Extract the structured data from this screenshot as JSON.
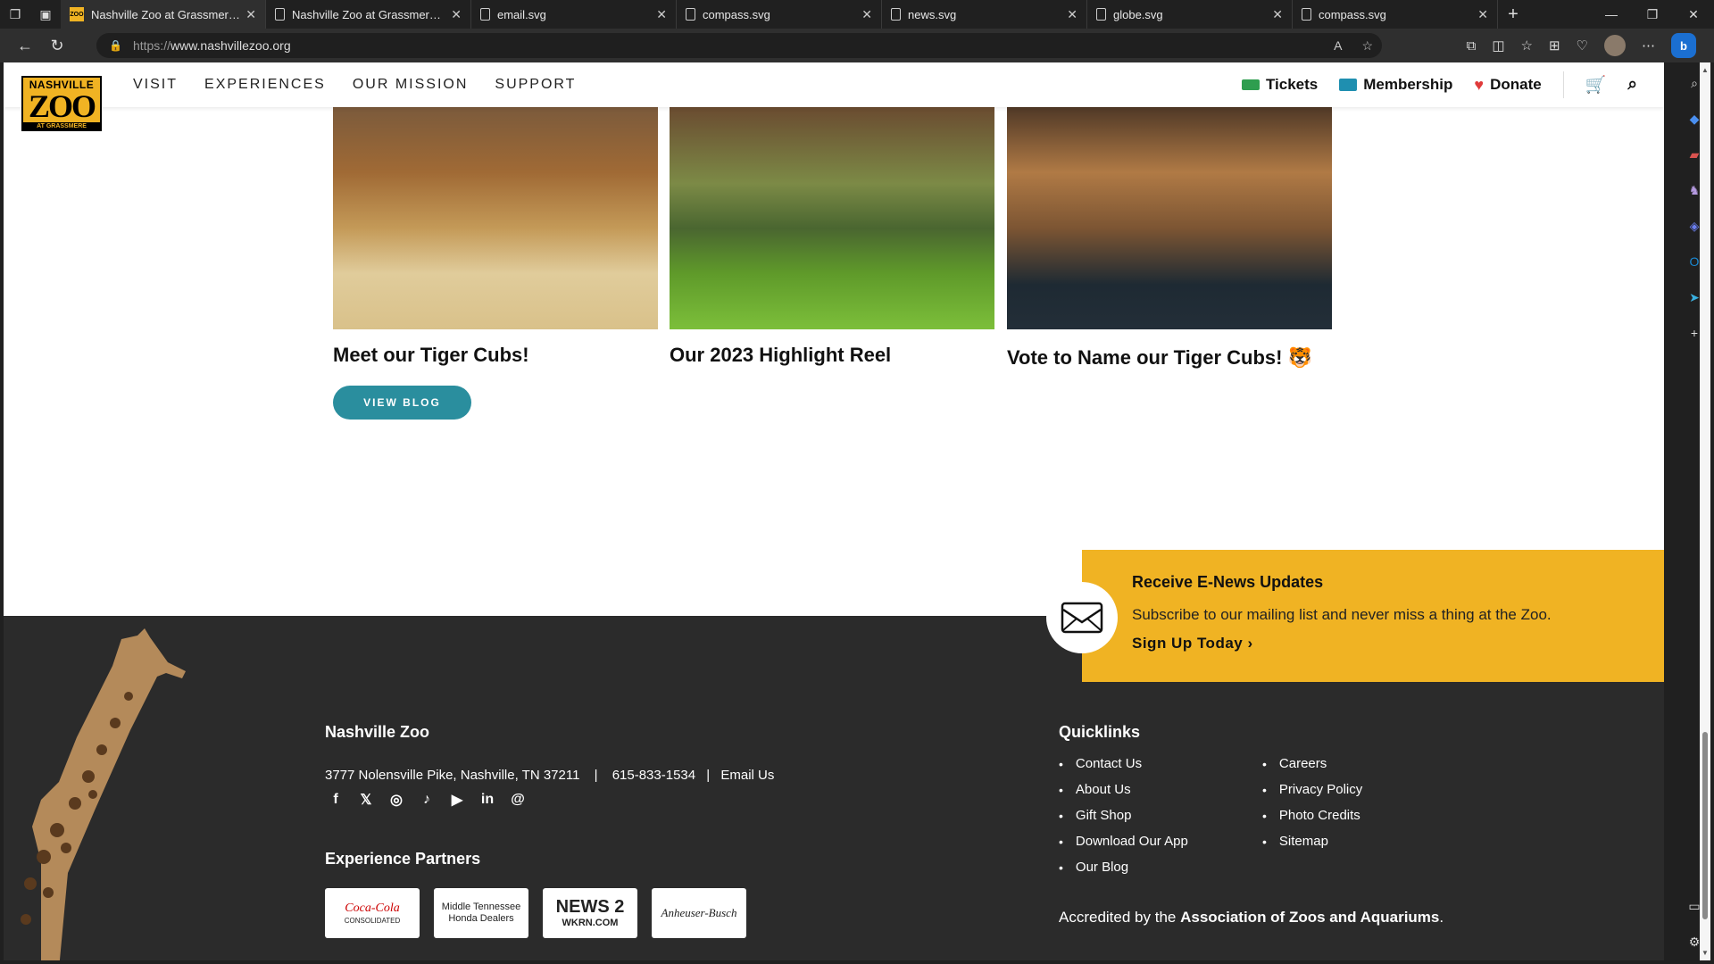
{
  "browser": {
    "tabs": [
      {
        "title": "Nashville Zoo at Grassmere | N",
        "active": true,
        "favicon": "zoo-favicon"
      },
      {
        "title": "Nashville Zoo at Grassmere | N",
        "active": false,
        "favicon": "page-icon"
      },
      {
        "title": "email.svg",
        "active": false,
        "favicon": "file-icon"
      },
      {
        "title": "compass.svg",
        "active": false,
        "favicon": "file-icon"
      },
      {
        "title": "news.svg",
        "active": false,
        "favicon": "file-icon"
      },
      {
        "title": "globe.svg",
        "active": false,
        "favicon": "file-icon"
      },
      {
        "title": "compass.svg",
        "active": false,
        "favicon": "file-icon"
      }
    ],
    "url_protocol": "https://",
    "url_host": "www.nashvillezoo.org"
  },
  "header": {
    "logo_top": "NASHVILLE",
    "logo_main": "ZOO",
    "logo_bottom": "AT GRASSMERE",
    "nav": [
      "VISIT",
      "EXPERIENCES",
      "OUR MISSION",
      "SUPPORT"
    ],
    "tickets": "Tickets",
    "membership": "Membership",
    "donate": "Donate"
  },
  "blog": {
    "cards": [
      {
        "title": "Meet our Tiger Cubs!"
      },
      {
        "title": "Our 2023 Highlight Reel"
      },
      {
        "title": "Vote to Name our Tiger Cubs! 🐯"
      }
    ],
    "button": "VIEW BLOG"
  },
  "enews": {
    "title": "Receive E-News Updates",
    "text": "Subscribe to our mailing list and never miss a thing at the Zoo.",
    "link": "Sign Up Today ›"
  },
  "footer": {
    "title": "Nashville Zoo",
    "address": "3777 Nolensville Pike, Nashville, TN 37211",
    "divider": "|",
    "phone": "615-833-1534",
    "email": "Email Us",
    "partners_title": "Experience Partners",
    "partners": [
      {
        "name": "Coca-Cola",
        "sub": "CONSOLIDATED"
      },
      {
        "name": "Middle Tennessee",
        "sub": "Honda Dealers"
      },
      {
        "name": "NEWS 2",
        "sub": "WKRN.COM"
      },
      {
        "name": "Anheuser-Busch",
        "sub": ""
      }
    ],
    "quicklinks_title": "Quicklinks",
    "quicklinks_col1": [
      "Contact Us",
      "About Us",
      "Gift Shop",
      "Download Our App",
      "Our Blog"
    ],
    "quicklinks_col2": [
      "Careers",
      "Privacy Policy",
      "Photo Credits",
      "Sitemap"
    ],
    "accredit_prefix": "Accredited by the",
    "accredit_org": "Association of Zoos and Aquariums",
    "accredit_suffix": "."
  }
}
